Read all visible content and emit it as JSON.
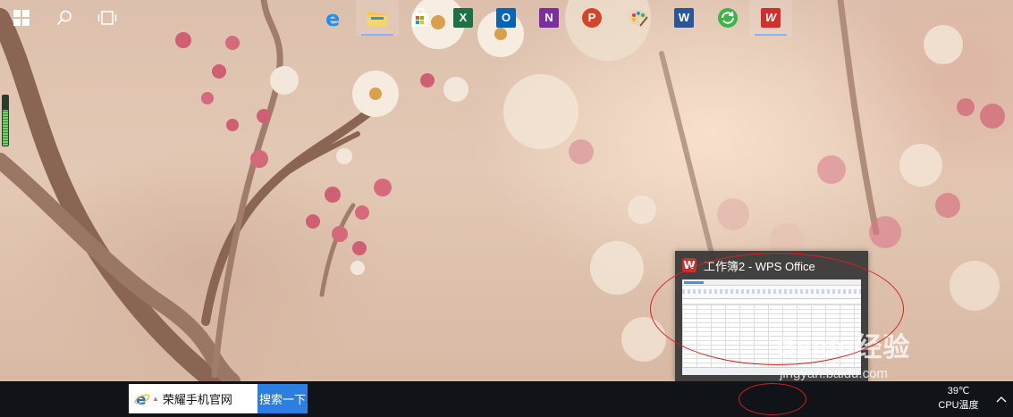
{
  "preview": {
    "title": "工作簿2 - WPS Office",
    "logo_letter": "W"
  },
  "search": {
    "query": "荣耀手机官网",
    "button_label": "搜索一下"
  },
  "taskbar": {
    "items": [
      {
        "name": "start",
        "icon": "windows-logo-icon"
      },
      {
        "name": "search",
        "icon": "magnifier-icon"
      },
      {
        "name": "task-view",
        "icon": "task-view-icon"
      },
      {
        "name": "edge",
        "icon": "edge-e-icon",
        "letter": "e"
      },
      {
        "name": "file-explorer",
        "icon": "folder-icon"
      },
      {
        "name": "store",
        "icon": "store-bag-icon"
      },
      {
        "name": "excel",
        "icon": "excel-icon",
        "letter": "X"
      },
      {
        "name": "outlook",
        "icon": "outlook-icon",
        "letter": "O"
      },
      {
        "name": "onenote",
        "icon": "onenote-icon",
        "letter": "N"
      },
      {
        "name": "powerpoint",
        "icon": "powerpoint-icon",
        "letter": "P"
      },
      {
        "name": "paint",
        "icon": "paint-palette-icon"
      },
      {
        "name": "word",
        "icon": "word-icon",
        "letter": "W"
      },
      {
        "name": "browser-360",
        "icon": "green-refresh-icon"
      },
      {
        "name": "wps",
        "icon": "wps-icon",
        "letter": "W",
        "active": true
      }
    ]
  },
  "tray": {
    "temperature": "39℃",
    "label": "CPU温度"
  },
  "watermark": {
    "brand": "Baidu经验",
    "url": "jingyan.baidu.com"
  },
  "colors": {
    "taskbar": "#101317",
    "search_button": "#2b7fe0",
    "annotation": "#d62020",
    "wps_red": "#d22e2e"
  }
}
